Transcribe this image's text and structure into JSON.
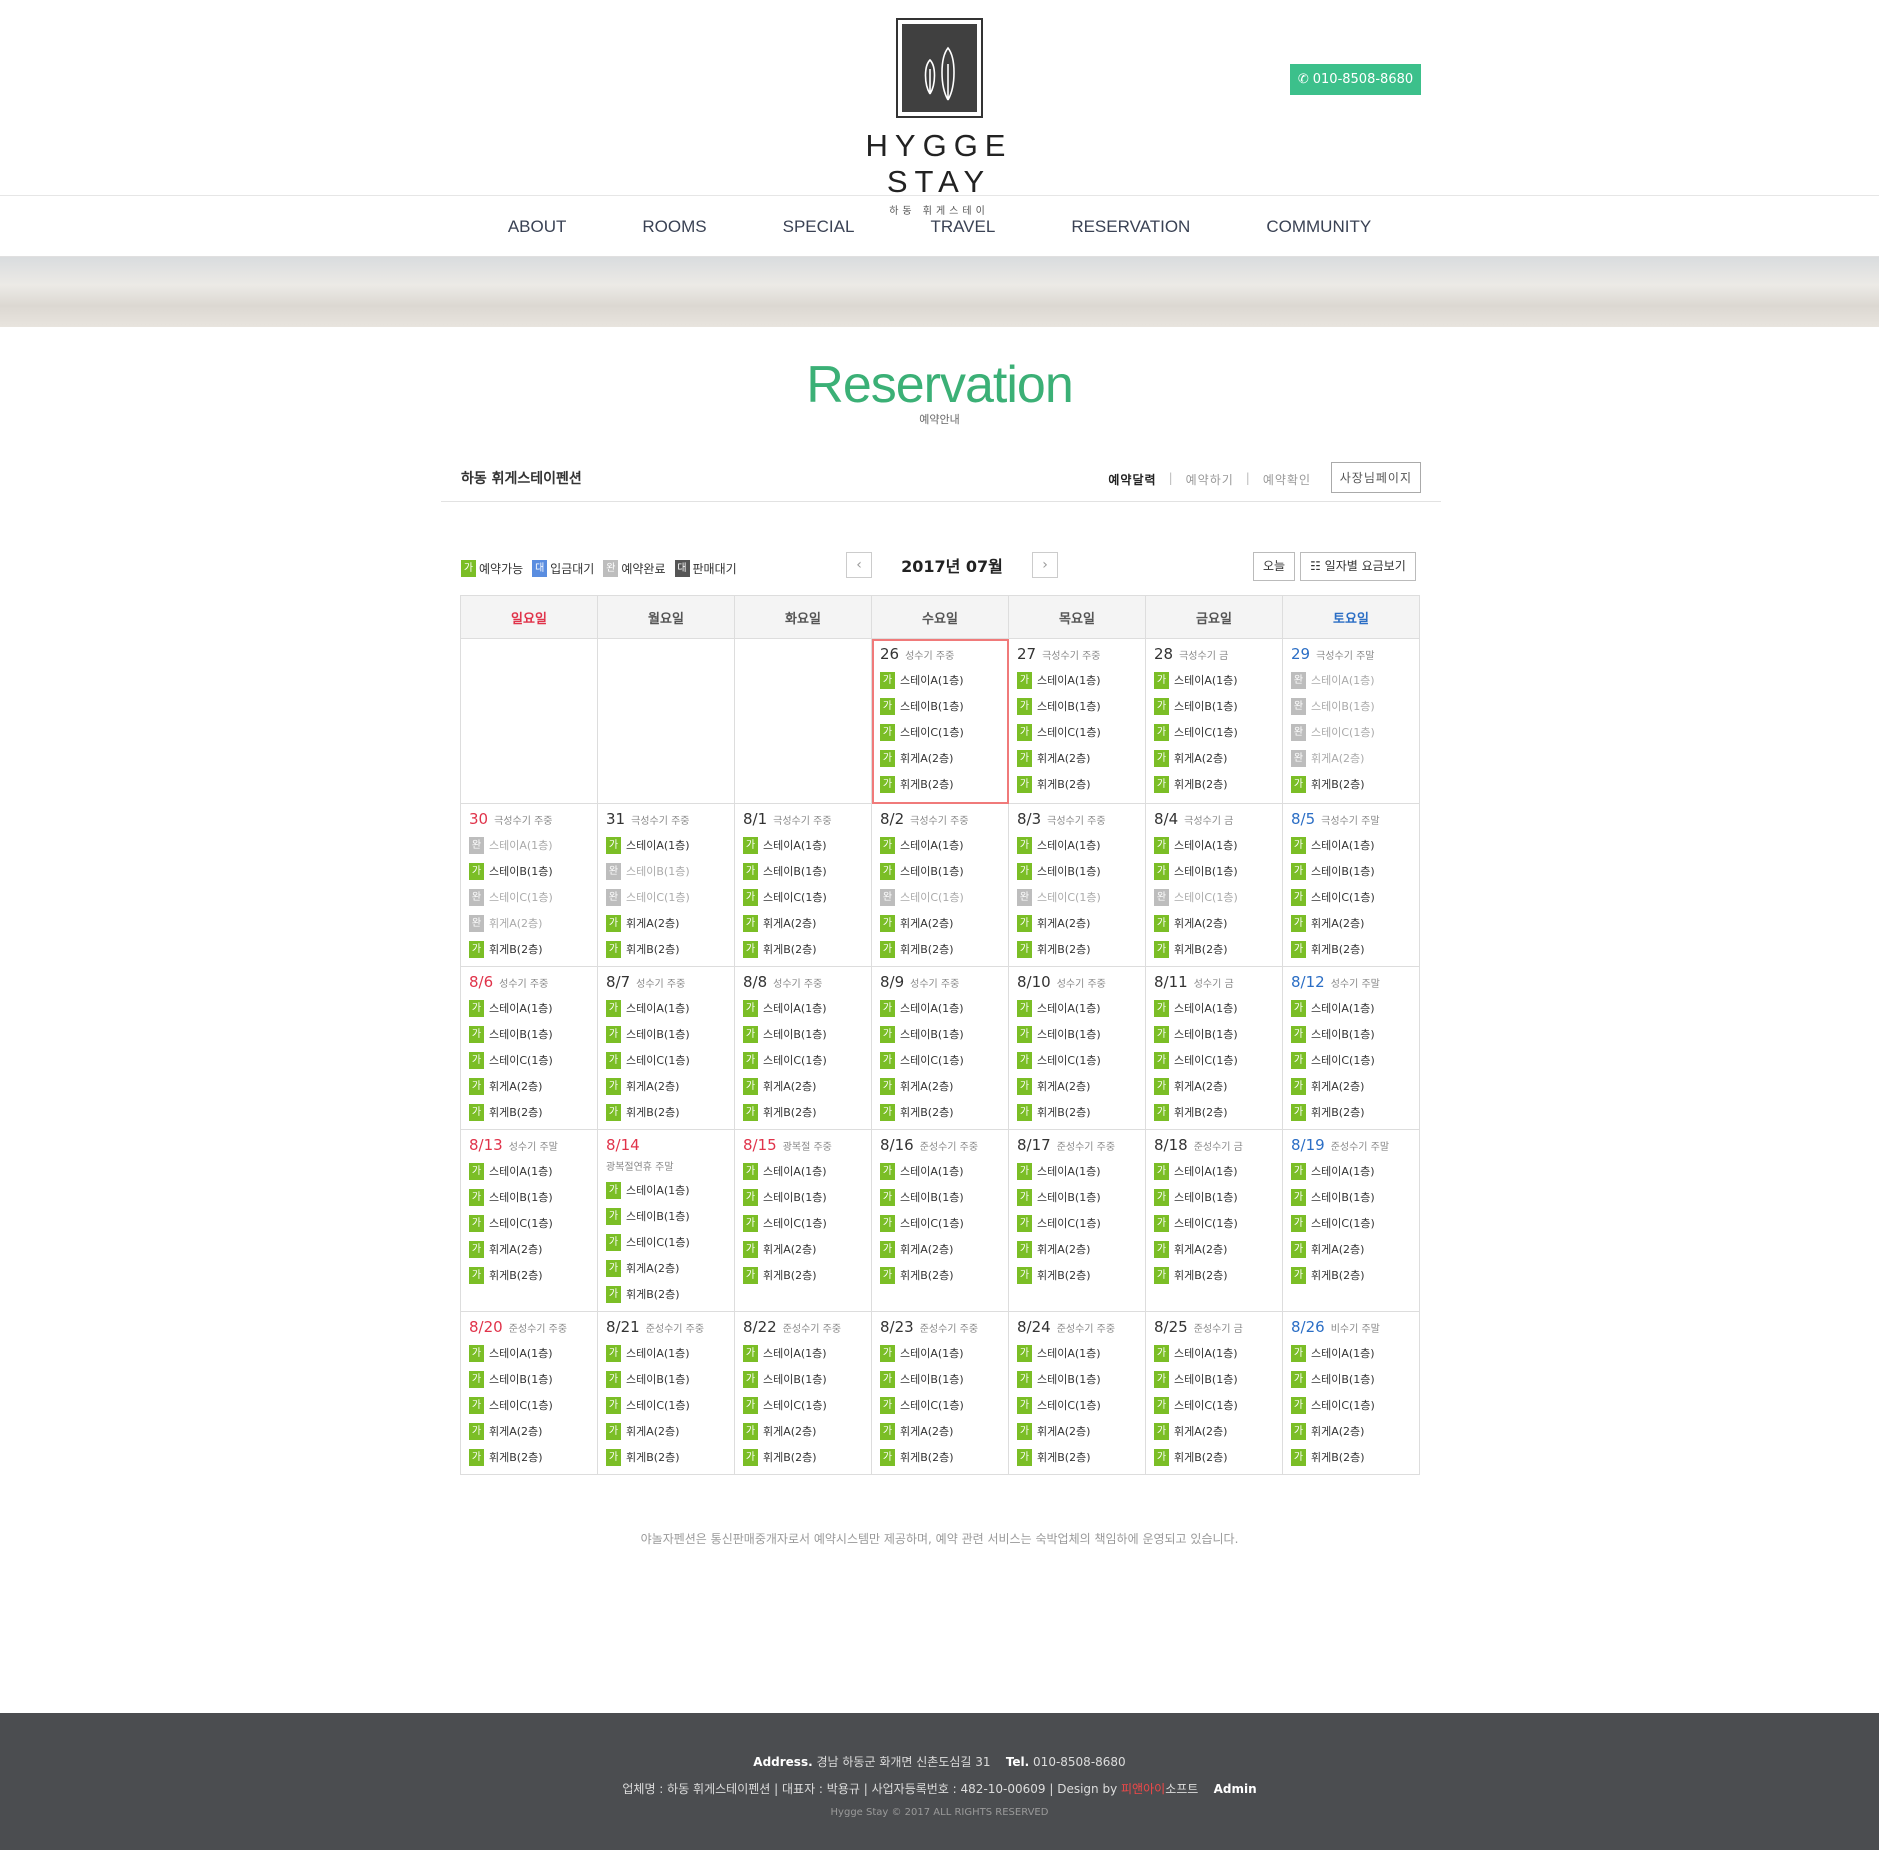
{
  "header": {
    "logo_text": "HYGGE STAY",
    "logo_sub": "하동 휘게스테이",
    "phone": "010-8508-8680"
  },
  "nav": [
    "ABOUT",
    "ROOMS",
    "SPECIAL",
    "TRAVEL",
    "RESERVATION",
    "COMMUNITY"
  ],
  "page": {
    "title": "Reservation",
    "subtitle": "예약안내"
  },
  "subhead": {
    "pension": "하동 휘게스테이펜션",
    "tabs": [
      "예약달력",
      "예약하기",
      "예약확인"
    ],
    "owner_button": "사장님페이지"
  },
  "legend": [
    {
      "mark": "가",
      "label": "예약가능",
      "kind": "av"
    },
    {
      "mark": "대",
      "label": "입금대기",
      "kind": "wt"
    },
    {
      "mark": "완",
      "label": "예약완료",
      "kind": "dn"
    },
    {
      "mark": "대",
      "label": "판매대기",
      "kind": "st"
    }
  ],
  "month_nav": {
    "label": "2017년 07월",
    "prev": "‹",
    "next": "›"
  },
  "buttons": {
    "today": "오늘",
    "rates": "☷ 일자별 요금보기"
  },
  "weekdays": [
    "일요일",
    "월요일",
    "화요일",
    "수요일",
    "목요일",
    "금요일",
    "토요일"
  ],
  "room_names": [
    "스테이A(1층)",
    "스테이B(1층)",
    "스테이C(1층)",
    "휘게A(2층)",
    "휘게B(2층)"
  ],
  "weeks": [
    [
      null,
      null,
      null,
      {
        "day": "26",
        "label": "성수기 주중",
        "rooms": [
          "가",
          "가",
          "가",
          "가",
          "가"
        ],
        "today": true
      },
      {
        "day": "27",
        "label": "극성수기 주중",
        "rooms": [
          "가",
          "가",
          "가",
          "가",
          "가"
        ]
      },
      {
        "day": "28",
        "label": "극성수기 금",
        "rooms": [
          "가",
          "가",
          "가",
          "가",
          "가"
        ]
      },
      {
        "day": "29",
        "label": "극성수기 주말",
        "rooms": [
          "완",
          "완",
          "완",
          "완",
          "가"
        ]
      }
    ],
    [
      {
        "day": "30",
        "label": "극성수기 주중",
        "rooms": [
          "완",
          "가",
          "완",
          "완",
          "가"
        ]
      },
      {
        "day": "31",
        "label": "극성수기 주중",
        "rooms": [
          "가",
          "완",
          "완",
          "가",
          "가"
        ]
      },
      {
        "day": "8/1",
        "label": "극성수기 주중",
        "rooms": [
          "가",
          "가",
          "가",
          "가",
          "가"
        ]
      },
      {
        "day": "8/2",
        "label": "극성수기 주중",
        "rooms": [
          "가",
          "가",
          "완",
          "가",
          "가"
        ]
      },
      {
        "day": "8/3",
        "label": "극성수기 주중",
        "rooms": [
          "가",
          "가",
          "완",
          "가",
          "가"
        ]
      },
      {
        "day": "8/4",
        "label": "극성수기 금",
        "rooms": [
          "가",
          "가",
          "완",
          "가",
          "가"
        ]
      },
      {
        "day": "8/5",
        "label": "극성수기 주말",
        "rooms": [
          "가",
          "가",
          "가",
          "가",
          "가"
        ]
      }
    ],
    [
      {
        "day": "8/6",
        "label": "성수기 주중",
        "rooms": [
          "가",
          "가",
          "가",
          "가",
          "가"
        ]
      },
      {
        "day": "8/7",
        "label": "성수기 주중",
        "rooms": [
          "가",
          "가",
          "가",
          "가",
          "가"
        ]
      },
      {
        "day": "8/8",
        "label": "성수기 주중",
        "rooms": [
          "가",
          "가",
          "가",
          "가",
          "가"
        ]
      },
      {
        "day": "8/9",
        "label": "성수기 주중",
        "rooms": [
          "가",
          "가",
          "가",
          "가",
          "가"
        ]
      },
      {
        "day": "8/10",
        "label": "성수기 주중",
        "rooms": [
          "가",
          "가",
          "가",
          "가",
          "가"
        ]
      },
      {
        "day": "8/11",
        "label": "성수기 금",
        "rooms": [
          "가",
          "가",
          "가",
          "가",
          "가"
        ]
      },
      {
        "day": "8/12",
        "label": "성수기 주말",
        "rooms": [
          "가",
          "가",
          "가",
          "가",
          "가"
        ]
      }
    ],
    [
      {
        "day": "8/13",
        "label": "성수기 주말",
        "rooms": [
          "가",
          "가",
          "가",
          "가",
          "가"
        ]
      },
      {
        "day": "8/14",
        "label": "",
        "label2": "광복절연휴 주말",
        "rooms": [
          "가",
          "가",
          "가",
          "가",
          "가"
        ],
        "red": true
      },
      {
        "day": "8/15",
        "label": "광복절 주중",
        "rooms": [
          "가",
          "가",
          "가",
          "가",
          "가"
        ],
        "red": true
      },
      {
        "day": "8/16",
        "label": "준성수기 주중",
        "rooms": [
          "가",
          "가",
          "가",
          "가",
          "가"
        ]
      },
      {
        "day": "8/17",
        "label": "준성수기 주중",
        "rooms": [
          "가",
          "가",
          "가",
          "가",
          "가"
        ]
      },
      {
        "day": "8/18",
        "label": "준성수기 금",
        "rooms": [
          "가",
          "가",
          "가",
          "가",
          "가"
        ]
      },
      {
        "day": "8/19",
        "label": "준성수기 주말",
        "rooms": [
          "가",
          "가",
          "가",
          "가",
          "가"
        ]
      }
    ],
    [
      {
        "day": "8/20",
        "label": "준성수기 주중",
        "rooms": [
          "가",
          "가",
          "가",
          "가",
          "가"
        ]
      },
      {
        "day": "8/21",
        "label": "준성수기 주중",
        "rooms": [
          "가",
          "가",
          "가",
          "가",
          "가"
        ]
      },
      {
        "day": "8/22",
        "label": "준성수기 주중",
        "rooms": [
          "가",
          "가",
          "가",
          "가",
          "가"
        ]
      },
      {
        "day": "8/23",
        "label": "준성수기 주중",
        "rooms": [
          "가",
          "가",
          "가",
          "가",
          "가"
        ]
      },
      {
        "day": "8/24",
        "label": "준성수기 주중",
        "rooms": [
          "가",
          "가",
          "가",
          "가",
          "가"
        ]
      },
      {
        "day": "8/25",
        "label": "준성수기 금",
        "rooms": [
          "가",
          "가",
          "가",
          "가",
          "가"
        ]
      },
      {
        "day": "8/26",
        "label": "비수기 주말",
        "rooms": [
          "가",
          "가",
          "가",
          "가",
          "가"
        ]
      }
    ]
  ],
  "notice": "야놀자펜션은 통신판매중개자로서 예약시스템만 제공하며, 예약 관련 서비스는 숙박업체의 책임하에 운영되고 있습니다.",
  "footer": {
    "addr_label": "Address.",
    "addr": "경남 하동군 화개면 신촌도심길 31",
    "tel_label": "Tel.",
    "tel": "010-8508-8680",
    "biz": "업체명 : 하동 휘게스테이펜션   |   대표자 : 박용규   |   사업자등록번호 : 482-10-00609   |   Design by",
    "design_red": "피앤아이",
    "design_rest": "소프트",
    "admin": "Admin",
    "copy": "Hygge Stay © 2017 ALL RIGHTS RESERVED"
  },
  "colors": {
    "accent": "#3bb076",
    "available": "#7bbe26",
    "footer_bg": "#4b4d50"
  }
}
